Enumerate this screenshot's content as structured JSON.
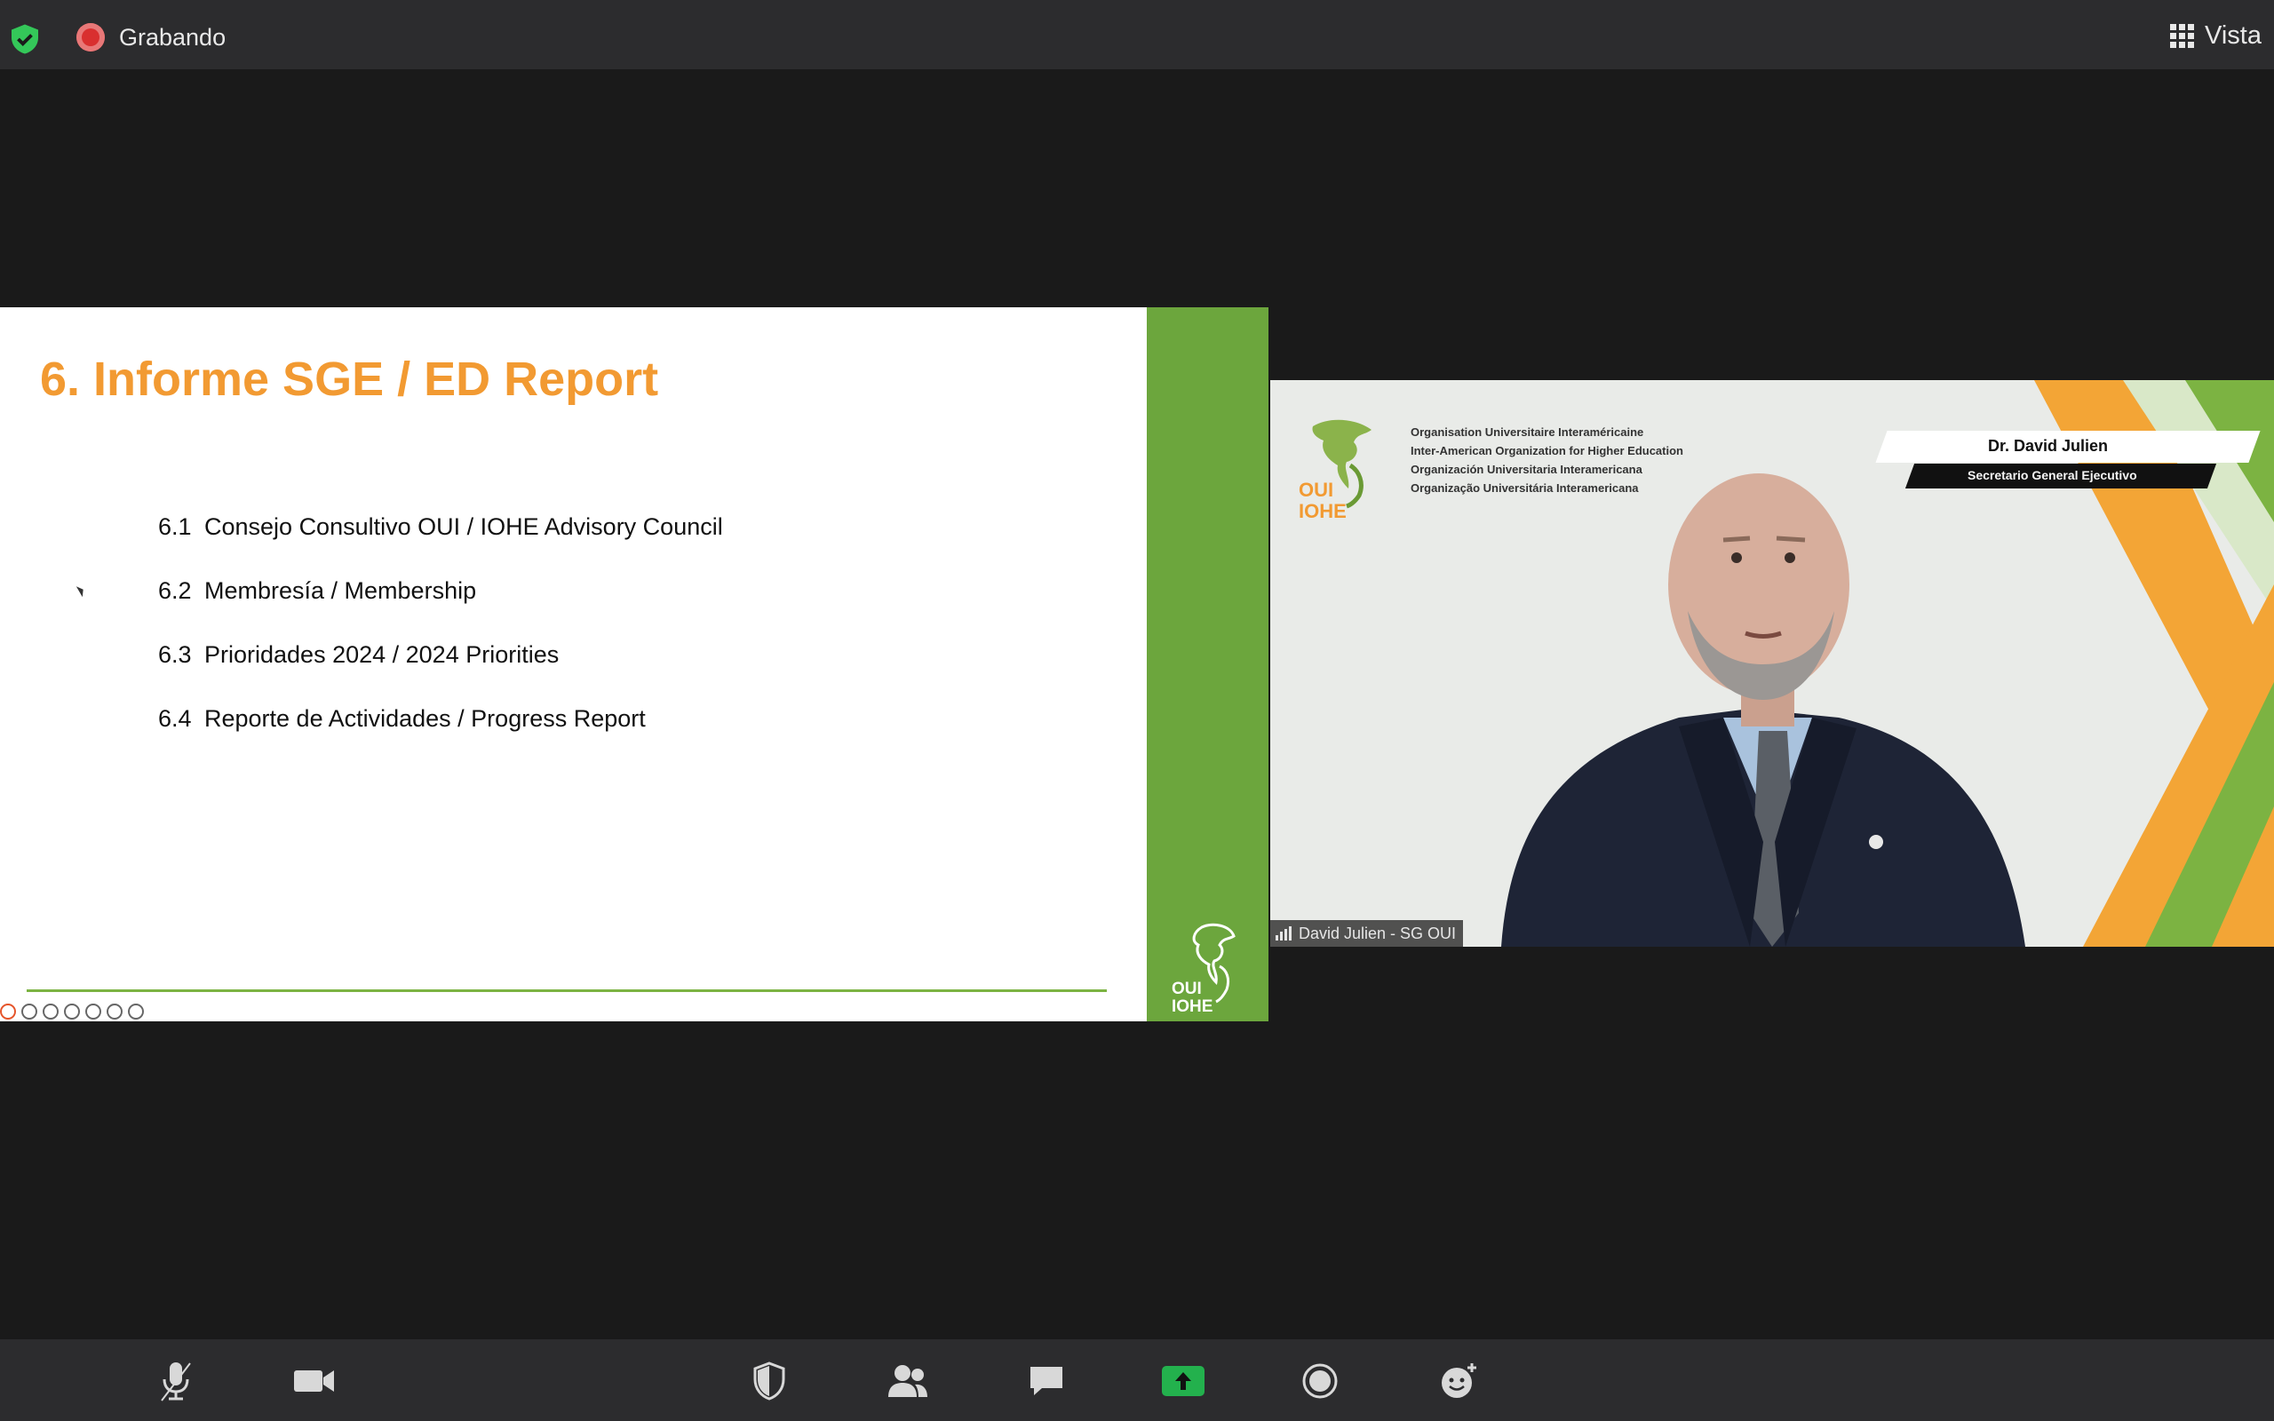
{
  "top_bar": {
    "recording_label": "Grabando",
    "view_label": "Vista"
  },
  "slide": {
    "title": "6. Informe SGE / ED Report",
    "items": [
      {
        "number": "6.1",
        "text": "Consejo Consultivo OUI / IOHE Advisory Council"
      },
      {
        "number": "6.2",
        "text": "Membresía / Membership"
      },
      {
        "number": "6.3",
        "text": "Prioridades 2024 / 2024 Priorities"
      },
      {
        "number": "6.4",
        "text": "Reporte de Actividades / Progress Report"
      }
    ],
    "logo_text": [
      "OUI",
      "IOHE"
    ]
  },
  "video": {
    "org_short": [
      "OUI",
      "IOHE"
    ],
    "org_names": [
      "Organisation Universitaire Interaméricaine",
      "Inter-American Organization for Higher Education",
      "Organización Universitaria Interamericana",
      "Organização Universitária Interamericana"
    ],
    "speaker_title_name": "Dr. David Julien",
    "speaker_role": "Secretario General Ejecutivo",
    "participant_name": "David Julien - SG OUI"
  },
  "colors": {
    "title_orange": "#f29a32",
    "band_green": "#6ca63d",
    "share_green": "#23b14d",
    "shield_green": "#34c759"
  },
  "toolbar_icons": [
    "microphone-icon",
    "video-camera-icon",
    "security-shield-icon",
    "participants-icon",
    "chat-icon",
    "share-screen-icon",
    "record-icon",
    "reactions-icon"
  ]
}
